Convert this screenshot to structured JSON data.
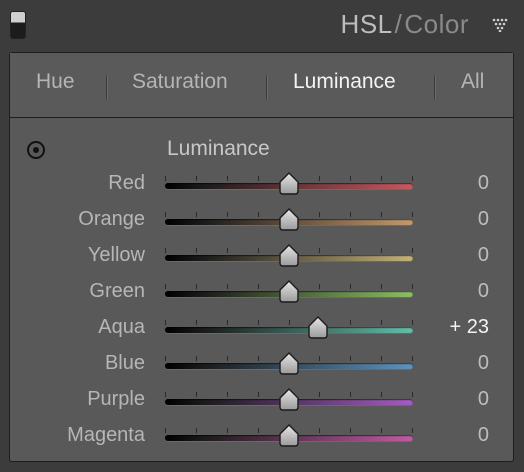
{
  "header": {
    "title_primary": "HSL",
    "title_separator": "/",
    "title_secondary": "Color"
  },
  "tabs": [
    {
      "label": "Hue",
      "active": false
    },
    {
      "label": "Saturation",
      "active": false
    },
    {
      "label": "Luminance",
      "active": true
    },
    {
      "label": "All",
      "active": false
    }
  ],
  "section": {
    "title": "Luminance"
  },
  "sliders": [
    {
      "label": "Red",
      "value": "0",
      "level": 0,
      "color": "#c9575e"
    },
    {
      "label": "Orange",
      "value": "0",
      "level": 0,
      "color": "#c4996b"
    },
    {
      "label": "Yellow",
      "value": "0",
      "level": 0,
      "color": "#c4b27a"
    },
    {
      "label": "Green",
      "value": "0",
      "level": 0,
      "color": "#8cbf62"
    },
    {
      "label": "Aqua",
      "value": "+ 23",
      "level": 23,
      "color": "#63bdaa"
    },
    {
      "label": "Blue",
      "value": "0",
      "level": 0,
      "color": "#5c93bf"
    },
    {
      "label": "Purple",
      "value": "0",
      "level": 0,
      "color": "#a45cc2"
    },
    {
      "label": "Magenta",
      "value": "0",
      "level": 0,
      "color": "#c25aa3"
    }
  ],
  "slider_range": [
    -100,
    100
  ],
  "icons": {
    "collapse": "panel-collapse-toggle-icon",
    "menu": "panel-menu-triangle-icon",
    "target": "targeted-adjustment-tool-icon"
  }
}
